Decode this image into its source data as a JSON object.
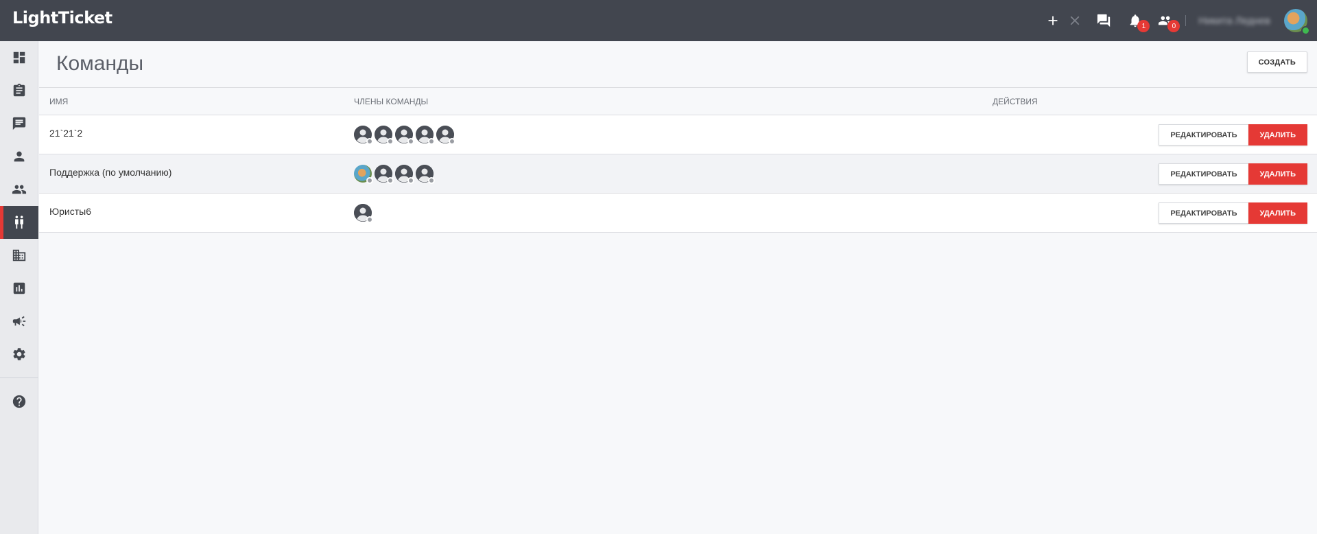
{
  "app": {
    "logo": "LightTicket"
  },
  "topbar": {
    "notifications_count": "1",
    "users_count": "0",
    "user_name": "Никита Леднев"
  },
  "sidebar": {
    "items": [
      {
        "icon": "dashboard-icon"
      },
      {
        "icon": "clipboard-icon"
      },
      {
        "icon": "chat-icon"
      },
      {
        "icon": "person-icon"
      },
      {
        "icon": "people-icon"
      },
      {
        "icon": "teams-icon",
        "active": true
      },
      {
        "icon": "building-icon"
      },
      {
        "icon": "chart-icon"
      },
      {
        "icon": "megaphone-icon"
      },
      {
        "icon": "gear-icon"
      },
      {
        "icon": "help-icon"
      }
    ]
  },
  "page": {
    "title": "Команды",
    "create_label": "СОЗДАТЬ"
  },
  "table": {
    "headers": {
      "name": "ИМЯ",
      "members": "ЧЛЕНЫ КОМАНДЫ",
      "actions": "ДЕЙСТВИЯ"
    },
    "edit_label": "РЕДАКТИРОВАТЬ",
    "delete_label": "УДАЛИТЬ",
    "rows": [
      {
        "name": "21`21`2",
        "members": 5,
        "photo_first": false
      },
      {
        "name": "Поддержка (по умолчанию)",
        "members": 4,
        "photo_first": true
      },
      {
        "name": "Юристы6",
        "members": 1,
        "photo_first": false
      }
    ]
  }
}
